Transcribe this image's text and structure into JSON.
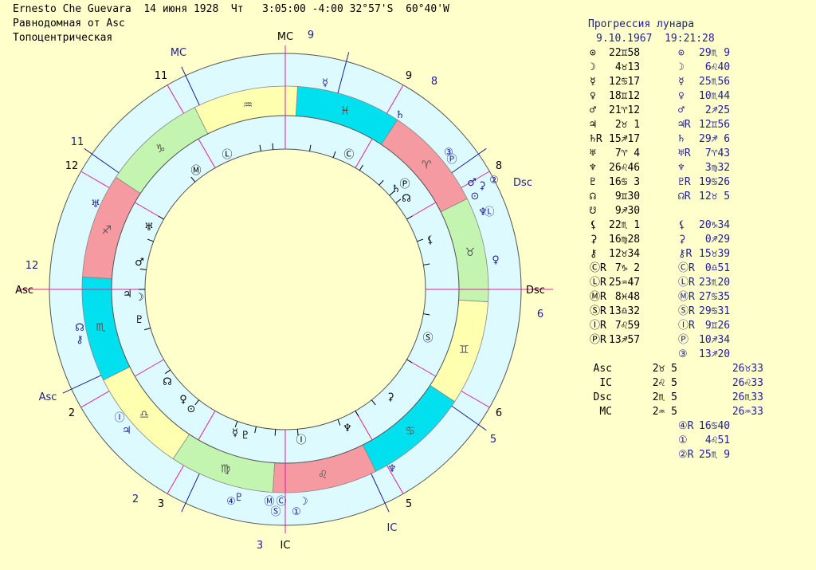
{
  "header": {
    "line1": "Ernesto Che Guevara  14 июня 1928  Чт   3:05:00 -4:00 32°57'S  60°40'W",
    "line2": "Равнодомная от Asc",
    "line3": "Топоцентрическая"
  },
  "right_header": {
    "title": "Прогрессия лунара",
    "date": "9.10.1967  19:21:28"
  },
  "natal_positions": [
    {
      "g": "⊙",
      "v": "22♊58"
    },
    {
      "g": "☽",
      "v": " 4♉13"
    },
    {
      "g": "☿",
      "v": "12♋17"
    },
    {
      "g": "♀",
      "v": "18♊12"
    },
    {
      "g": "♂",
      "v": "21♈12"
    },
    {
      "g": "♃",
      "v": " 2♉ 1"
    },
    {
      "g": "♄R",
      "v": "15♐17"
    },
    {
      "g": "♅",
      "v": " 7♈ 4"
    },
    {
      "g": "♆",
      "v": "26♌46"
    },
    {
      "g": "♇",
      "v": "16♋ 3"
    },
    {
      "g": "☊",
      "v": " 9♊30"
    },
    {
      "g": "☋",
      "v": " 9♐30"
    },
    {
      "g": "⚸",
      "v": "22♏ 1"
    },
    {
      "g": "⚳",
      "v": "16♍28"
    },
    {
      "g": "⚷",
      "v": "12♉34"
    },
    {
      "g": "ⒸR",
      "v": " 7♑ 2"
    },
    {
      "g": "ⓁR",
      "v": "25♒47"
    },
    {
      "g": "ⓂR",
      "v": " 8♓48"
    },
    {
      "g": "ⓈR",
      "v": "13♎32"
    },
    {
      "g": "ⒾR",
      "v": " 7♌59"
    },
    {
      "g": "ⓅR",
      "v": "13♐57"
    }
  ],
  "progressed_positions": [
    {
      "g": "⊙",
      "v": "29♏ 9"
    },
    {
      "g": "☽",
      "v": " 6♌40"
    },
    {
      "g": "☿",
      "v": "25♏56"
    },
    {
      "g": "♀",
      "v": "10♏44"
    },
    {
      "g": "♂",
      "v": " 2♐25"
    },
    {
      "g": "♃R",
      "v": "12♊56"
    },
    {
      "g": "♄",
      "v": "29♐ 6"
    },
    {
      "g": "♅R",
      "v": " 7♈43"
    },
    {
      "g": "♆",
      "v": " 3♍32"
    },
    {
      "g": "♇R",
      "v": "19♋26"
    },
    {
      "g": "☊R",
      "v": "12♉ 5"
    },
    {
      "g": "",
      "v": ""
    },
    {
      "g": "⚸",
      "v": "20♑34"
    },
    {
      "g": "⚳",
      "v": " 0♐29"
    },
    {
      "g": "⚷R",
      "v": "15♉39"
    },
    {
      "g": "ⒸR",
      "v": " 0♎51"
    },
    {
      "g": "ⓁR",
      "v": "23♏20"
    },
    {
      "g": "ⓂR",
      "v": "27♋35"
    },
    {
      "g": "ⓈR",
      "v": "29♋31"
    },
    {
      "g": "ⒾR",
      "v": " 9♊26"
    },
    {
      "g": "Ⓟ",
      "v": "10♐34"
    },
    {
      "g": "③",
      "v": "13♐20"
    }
  ],
  "angles": [
    {
      "name": "Asc",
      "natal": "2♉ 5",
      "prog": "26♉33"
    },
    {
      "name": "IC",
      "natal": "2♌ 5",
      "prog": "26♌33"
    },
    {
      "name": "Dsc",
      "natal": "2♏ 5",
      "prog": "26♏33"
    },
    {
      "name": "MC",
      "natal": "2♒ 5",
      "prog": "26♒33"
    }
  ],
  "extra_points": [
    {
      "g": "④R",
      "v": "16♋40"
    },
    {
      "g": "①",
      "v": " 4♌51"
    },
    {
      "g": "②R",
      "v": "25♏ 9"
    }
  ],
  "wheel": {
    "angle_labels": {
      "mc": "MC",
      "ic": "IC",
      "asc": "Asc",
      "dsc": "Dsc"
    },
    "prog_angle_labels": {
      "mc": "MC",
      "ic": "IC",
      "asc": "Asc",
      "dsc": "Dsc"
    },
    "natal_house_numbers": [
      "12",
      "11",
      "2",
      "3",
      "5",
      "6",
      "8",
      "9"
    ],
    "prog_house_numbers": [
      "12",
      "11",
      "9",
      "8",
      "6",
      "5",
      "3",
      "2"
    ],
    "signs": [
      "♒",
      "♑",
      "♐",
      "♏",
      "♎",
      "♍",
      "♌",
      "♋",
      "♊",
      "♉",
      "♈",
      "♓"
    ],
    "sign_colors": [
      "#ffffb0",
      "#c4f5b0",
      "#f59aa0",
      "#00e0ee"
    ]
  }
}
